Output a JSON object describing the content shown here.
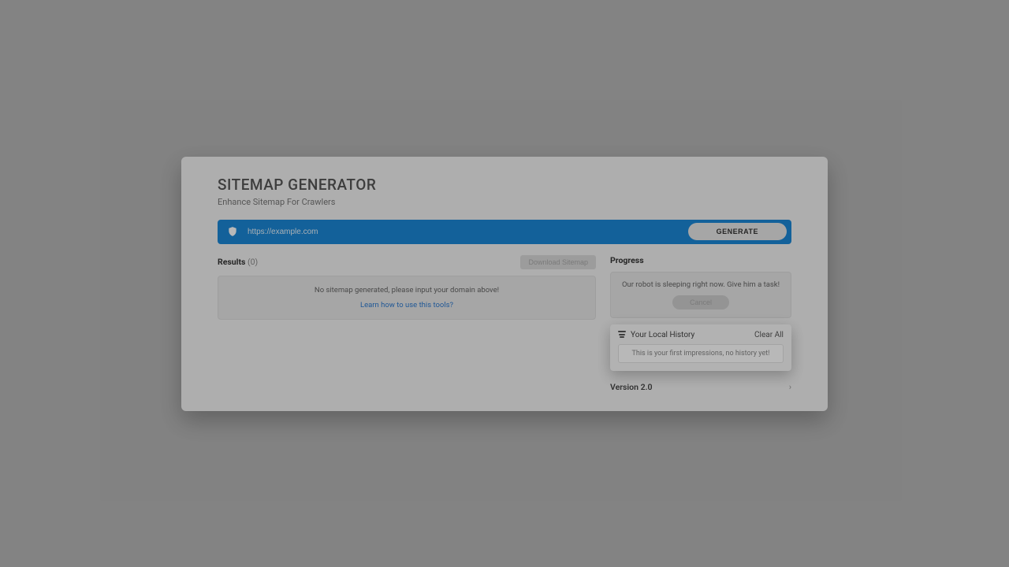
{
  "header": {
    "title": "SITEMAP GENERATOR",
    "subtitle": "Enhance Sitemap For Crawlers"
  },
  "urlbar": {
    "placeholder": "https://example.com",
    "generate_label": "GENERATE"
  },
  "results": {
    "label": "Results",
    "count": "(0)",
    "download_label": "Download Sitemap",
    "empty_msg": "No sitemap generated, please input your domain above!",
    "learn_link": "Learn how to use this tools?"
  },
  "progress": {
    "label": "Progress",
    "idle_msg": "Our robot is sleeping right now. Give him a task!",
    "cancel_label": "Cancel"
  },
  "history": {
    "title": "Your Local History",
    "clear_label": "Clear All",
    "empty_msg": "This is your first impressions, no history yet!"
  },
  "version": {
    "label": "Version 2.0",
    "chev": "›"
  }
}
